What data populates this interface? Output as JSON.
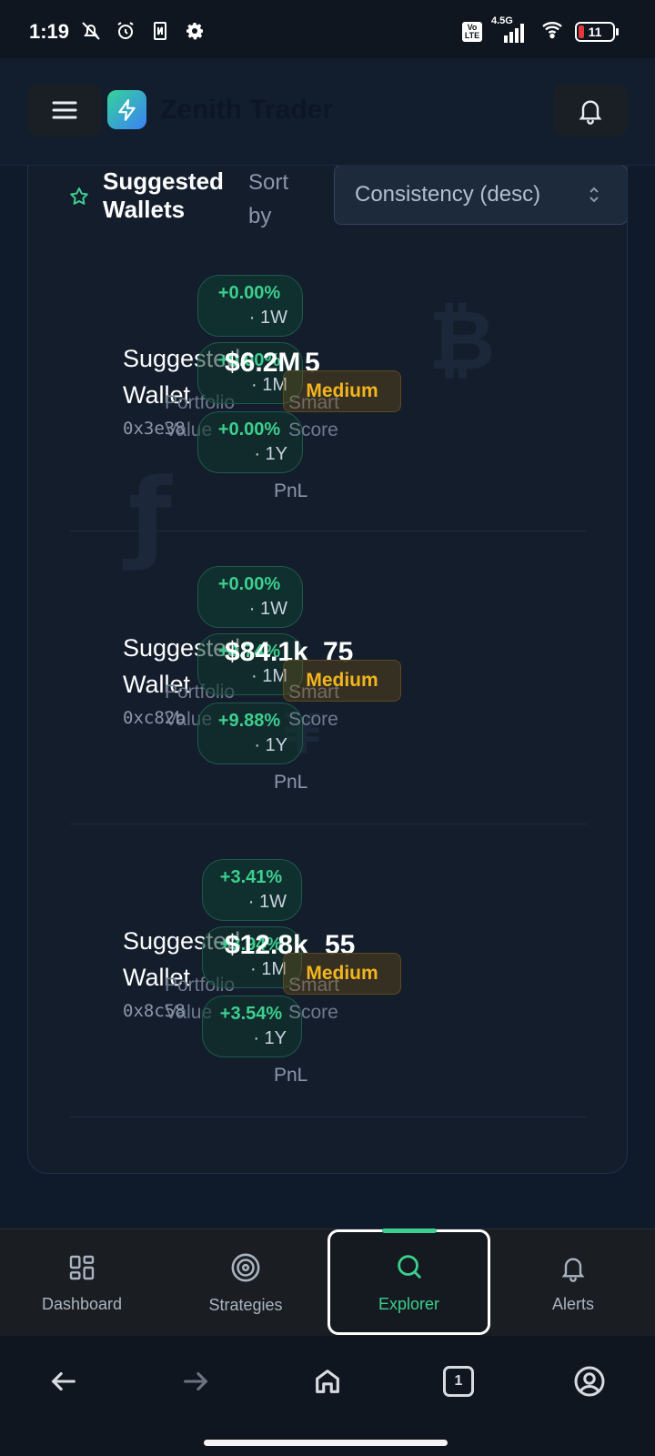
{
  "status_bar": {
    "time": "1:19",
    "network": "4.5G",
    "volte": "Vo LTE",
    "battery": "11"
  },
  "header": {
    "app_title": "Zenith Trader"
  },
  "panel": {
    "title": "Suggested Wallets",
    "sort_label": "Sort by",
    "sort_value": "Consistency (desc)"
  },
  "labels": {
    "portfolio_value": "Portfolio Value",
    "smart_score": "Smart Score",
    "pnl": "PnL"
  },
  "wallets": [
    {
      "name": "Suggested Wallet",
      "address": "0x3e38",
      "portfolio_value": "$6.2M",
      "smart_score": "5",
      "risk": "Medium",
      "pnl": [
        {
          "pct": "+0.00%",
          "period": "· 1W"
        },
        {
          "pct": "+0.00%",
          "period": "· 1M"
        },
        {
          "pct": "+0.00%",
          "period": "· 1Y"
        }
      ]
    },
    {
      "name": "Suggested Wallet",
      "address": "0xc82b",
      "portfolio_value": "$84.1k",
      "smart_score": "75",
      "risk": "Medium",
      "pnl": [
        {
          "pct": "+0.00%",
          "period": "· 1W"
        },
        {
          "pct": "+4.74%",
          "period": "· 1M"
        },
        {
          "pct": "+9.88%",
          "period": "· 1Y"
        }
      ]
    },
    {
      "name": "Suggested Wallet",
      "address": "0x8c58",
      "portfolio_value": "$12.8k",
      "smart_score": "55",
      "risk": "Medium",
      "pnl": [
        {
          "pct": "+3.41%",
          "period": "· 1W"
        },
        {
          "pct": "+3.94%",
          "period": "· 1M"
        },
        {
          "pct": "+3.54%",
          "period": "· 1Y"
        }
      ]
    }
  ],
  "bottom_nav": [
    {
      "label": "Dashboard"
    },
    {
      "label": "Strategies"
    },
    {
      "label": "Explorer"
    },
    {
      "label": "Alerts"
    }
  ],
  "system_nav": {
    "tab_count": "1"
  },
  "colors": {
    "accent": "#3ccf8e",
    "risk_medium": "#f2b51e",
    "background": "#0f1a2b"
  }
}
